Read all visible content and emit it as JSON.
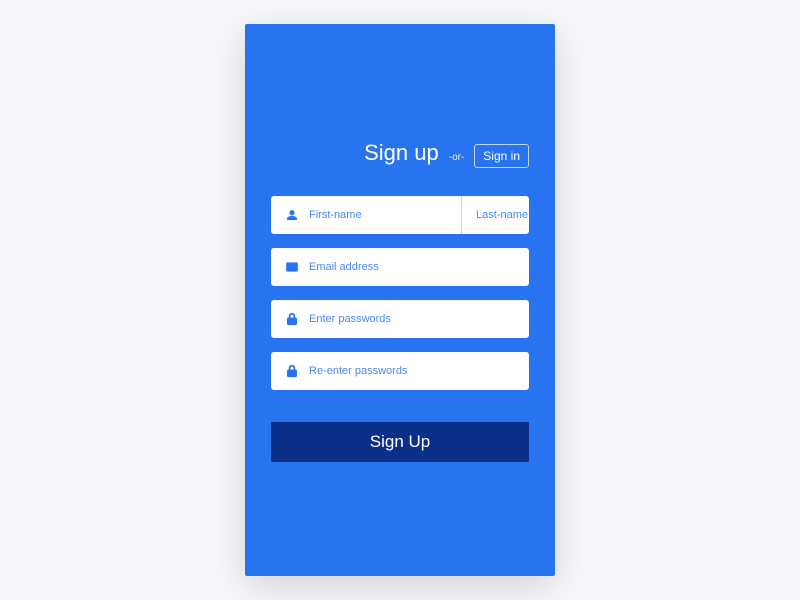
{
  "header": {
    "title": "Sign up",
    "or_label": "-or-",
    "signin_label": "Sign in"
  },
  "fields": {
    "first_name": {
      "placeholder": "First-name",
      "value": ""
    },
    "last_name": {
      "placeholder": "Last-name",
      "value": ""
    },
    "email": {
      "placeholder": "Email address",
      "value": ""
    },
    "password": {
      "placeholder": "Enter passwords",
      "value": ""
    },
    "password_confirm": {
      "placeholder": "Re-enter passwords",
      "value": ""
    }
  },
  "submit": {
    "label": "Sign Up"
  },
  "colors": {
    "primary": "#2874f0",
    "dark": "#0c2f8a",
    "white": "#ffffff"
  }
}
